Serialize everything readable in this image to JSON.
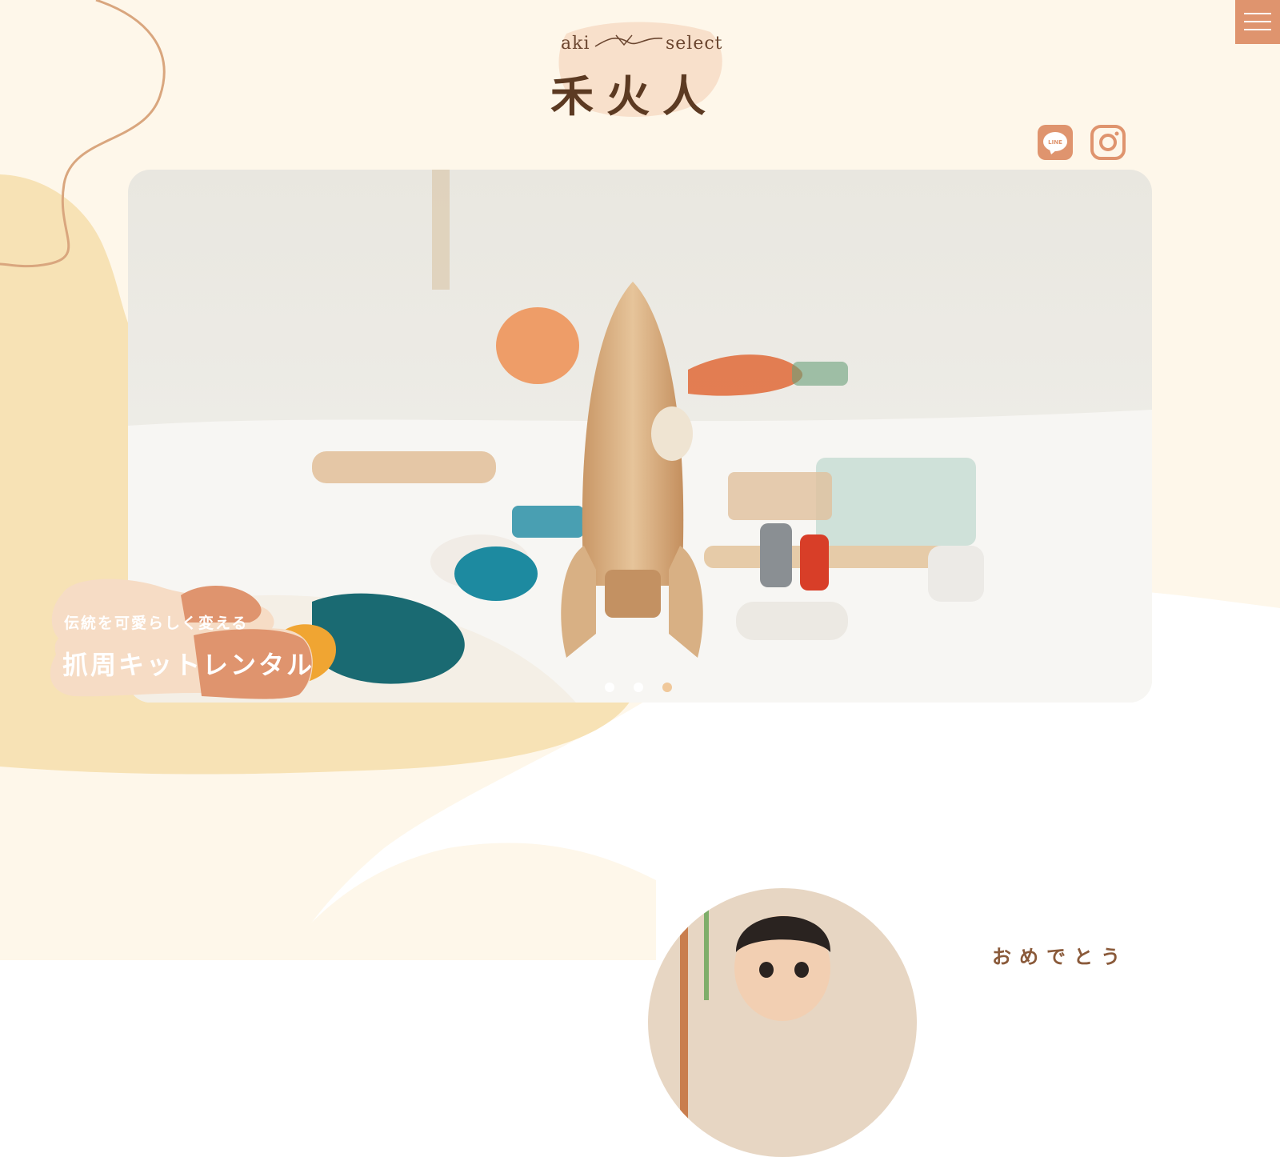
{
  "logo": {
    "aki": "aki",
    "select": "select",
    "name": "禾火人"
  },
  "header": {
    "menu_icon": "hamburger-icon",
    "social": [
      {
        "name": "line",
        "icon": "line-icon",
        "text": "LINE"
      },
      {
        "name": "instagram",
        "icon": "instagram-icon"
      }
    ]
  },
  "hero": {
    "badge_subtitle": "伝統を可愛らしく変える",
    "badge_title": "抓周キットレンタル",
    "slide_count": 3,
    "active_slide": 3
  },
  "section": {
    "heading_partial": "おめでとう"
  },
  "colors": {
    "background_cream": "#fef7ea",
    "blob_yellow": "#f7e2b5",
    "accent_orange": "#df946e",
    "wave_line": "#d9a67e",
    "text_brown": "#5c3a22"
  }
}
